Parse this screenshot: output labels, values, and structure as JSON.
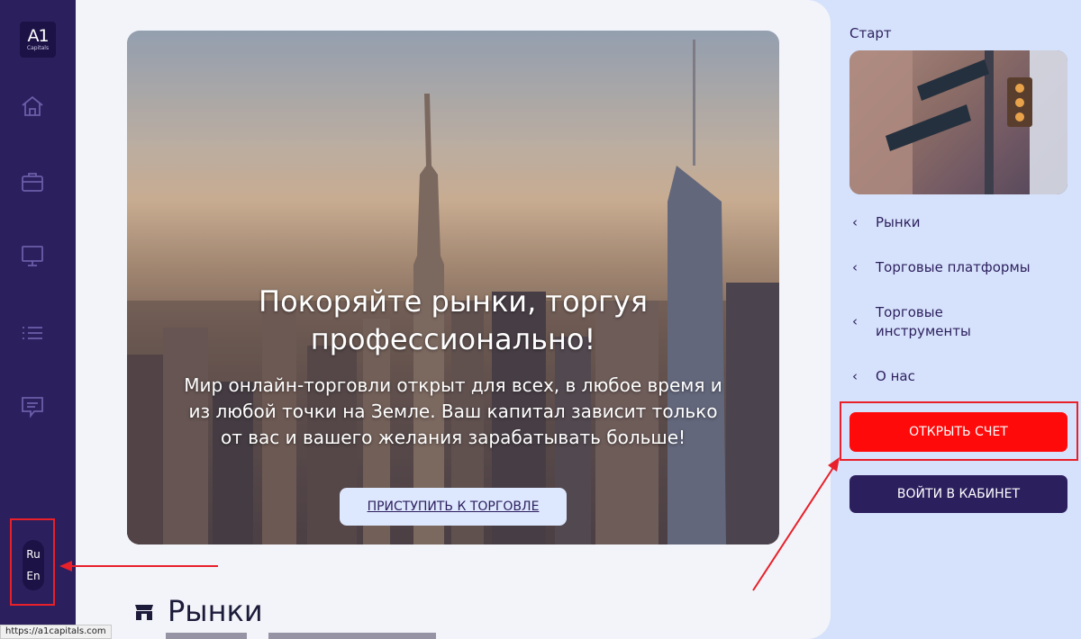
{
  "logo": {
    "main": "A1",
    "sub": "Capitals"
  },
  "sidebar": {
    "icons": [
      "home-icon",
      "briefcase-icon",
      "monitor-icon",
      "list-icon",
      "chat-icon"
    ],
    "languages": [
      "Ru",
      "En"
    ]
  },
  "hero": {
    "title_line1": "Покоряйте рынки, торгуя",
    "title_line2": "профессионально!",
    "text": "Мир онлайн-торговли открыт для всех, в любое время и из любой точки на Земле. Ваш капитал зависит только от вас и вашего желания зарабатывать больше!",
    "button": "ПРИСТУПИТЬ К ТОРГОВЛЕ"
  },
  "section": {
    "title": "Рынки",
    "icon": "shop-icon"
  },
  "status_url": "https://a1capitals.com",
  "right": {
    "start_label": "Старт",
    "menu": [
      {
        "label": "Рынки"
      },
      {
        "label": "Торговые платформы"
      },
      {
        "label": "Торговые инструменты"
      },
      {
        "label": "О нас"
      }
    ],
    "open_account": "ОТКРЫТЬ СЧЕТ",
    "login": "ВОЙТИ В КАБИНЕТ"
  },
  "colors": {
    "sidebar": "#2c1f5e",
    "open_button": "#ff0a0a",
    "login_button": "#2c1f5e",
    "annotation": "#e8202a",
    "right_panel": "#d6e2fb"
  }
}
